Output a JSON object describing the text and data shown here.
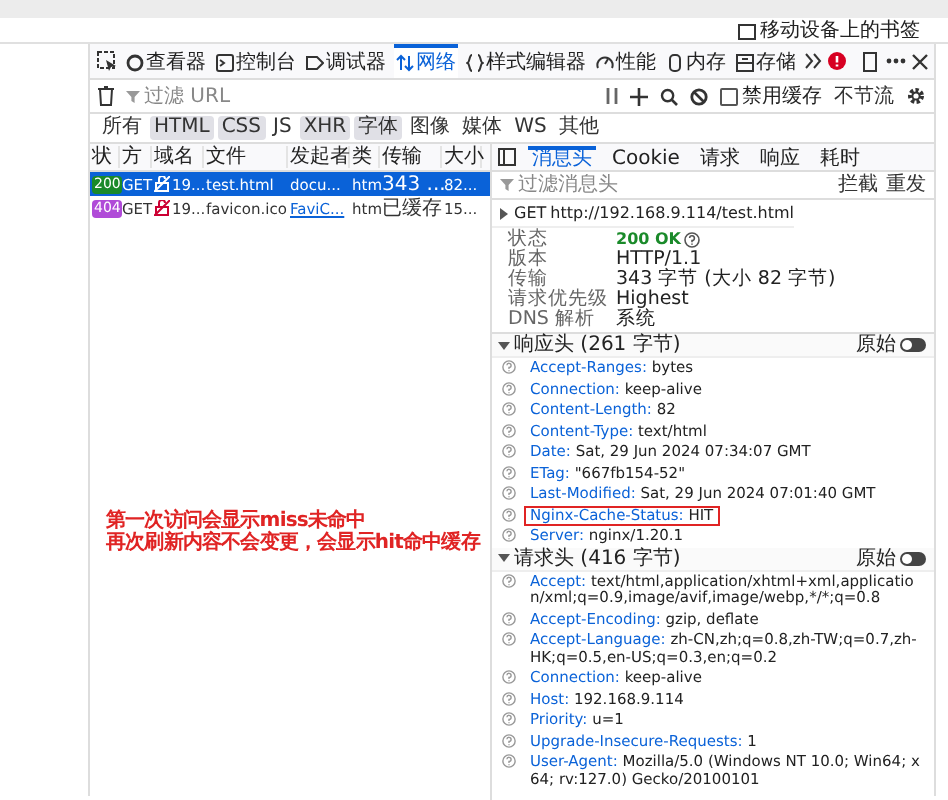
{
  "bookmarks_bar": {
    "label": "移动设备上的书签"
  },
  "toolbar": {
    "tabs": [
      {
        "label": "查看器",
        "selected": false
      },
      {
        "label": "控制台",
        "selected": false
      },
      {
        "label": "调试器",
        "selected": false
      },
      {
        "label": "网络",
        "selected": true
      },
      {
        "label": "样式编辑器",
        "selected": false
      },
      {
        "label": "性能",
        "selected": false
      },
      {
        "label": "内存",
        "selected": false
      },
      {
        "label": "存储",
        "selected": false
      }
    ]
  },
  "filter_bar": {
    "placeholder": "过滤 URL",
    "disable_cache": {
      "label": "禁用缓存",
      "checked": false
    },
    "throttle": "不节流"
  },
  "type_filters": [
    {
      "label": "所有",
      "selected": false
    },
    {
      "label": "HTML",
      "selected": true
    },
    {
      "label": "CSS",
      "selected": true
    },
    {
      "label": "JS",
      "selected": false
    },
    {
      "label": "XHR",
      "selected": true
    },
    {
      "label": "字体",
      "selected": true
    },
    {
      "label": "图像",
      "selected": false
    },
    {
      "label": "媒体",
      "selected": false
    },
    {
      "label": "WS",
      "selected": false
    },
    {
      "label": "其他",
      "selected": false
    }
  ],
  "requests": {
    "columns": [
      "状",
      "方",
      "域名",
      "文件",
      "发起者",
      "类",
      "传输",
      "大小"
    ],
    "rows": [
      {
        "status": "200",
        "color": "#1a8a2a",
        "method": "GET",
        "domain": "19...",
        "file": "test.html",
        "initiator": "docu...",
        "type": "htm",
        "transferred": "343 ...",
        "size": "82...",
        "selected": true
      },
      {
        "status": "404",
        "color": "#b04bd8",
        "method": "GET",
        "domain": "19...",
        "file": "favicon.ico",
        "initiator": "FaviC...",
        "type": "htm",
        "transferred": "已缓存",
        "size": "15...",
        "selected": false
      }
    ]
  },
  "details": {
    "tabs": [
      {
        "label": "消息头",
        "selected": true
      },
      {
        "label": "Cookie",
        "selected": false
      },
      {
        "label": "请求",
        "selected": false
      },
      {
        "label": "响应",
        "selected": false
      },
      {
        "label": "耗时",
        "selected": false
      }
    ],
    "filter_placeholder": "过滤消息头",
    "actions": [
      "拦截",
      "重发"
    ],
    "request_line": {
      "expanded": false,
      "method": "GET",
      "url": "http://192.168.9.114/test.html"
    },
    "summary": [
      {
        "kind": "status",
        "label": "状态",
        "value": "200 OK"
      },
      {
        "kind": "text",
        "label": "版本",
        "value": "HTTP/1.1"
      },
      {
        "kind": "text",
        "label": "传输",
        "value": "343 字节 (大小 82 字节)"
      },
      {
        "kind": "text",
        "label": "请求优先级",
        "value": "Highest"
      },
      {
        "kind": "text",
        "label": "DNS 解析",
        "value": "系统"
      }
    ],
    "sections": [
      {
        "title": "响应头 (261 字节)",
        "expanded": true,
        "raw_label": "原始",
        "raw_on": false,
        "headers": [
          {
            "name": "Accept-Ranges:",
            "value": "bytes",
            "highlighted": false
          },
          {
            "name": "Connection:",
            "value": "keep-alive",
            "highlighted": false
          },
          {
            "name": "Content-Length:",
            "value": "82",
            "highlighted": false
          },
          {
            "name": "Content-Type:",
            "value": "text/html",
            "highlighted": false
          },
          {
            "name": "Date:",
            "value": "Sat, 29 Jun 2024 07:34:07 GMT",
            "highlighted": false
          },
          {
            "name": "ETag:",
            "value": "\"667fb154-52\"",
            "highlighted": false
          },
          {
            "name": "Last-Modified:",
            "value": "Sat, 29 Jun 2024 07:01:40 GMT",
            "highlighted": false
          },
          {
            "name": "Nginx-Cache-Status:",
            "value": "HIT",
            "highlighted": true
          },
          {
            "name": "Server:",
            "value": "nginx/1.20.1",
            "highlighted": false
          }
        ]
      },
      {
        "title": "请求头 (416 字节)",
        "expanded": true,
        "raw_label": "原始",
        "raw_on": false,
        "headers": [
          {
            "name": "Accept:",
            "value": "text/html,application/xhtml+xml,application/xml;q=0.9,image/avif,image/webp,*/*;q=0.8",
            "highlighted": false
          },
          {
            "name": "Accept-Encoding:",
            "value": "gzip, deflate",
            "highlighted": false
          },
          {
            "name": "Accept-Language:",
            "value": "zh-CN,zh;q=0.8,zh-TW;q=0.7,zh-HK;q=0.5,en-US;q=0.3,en;q=0.2",
            "highlighted": false
          },
          {
            "name": "Connection:",
            "value": "keep-alive",
            "highlighted": false
          },
          {
            "name": "Host:",
            "value": "192.168.9.114",
            "highlighted": false
          },
          {
            "name": "Priority:",
            "value": "u=1",
            "highlighted": false
          },
          {
            "name": "Upgrade-Insecure-Requests:",
            "value": "1",
            "highlighted": false
          },
          {
            "name": "User-Agent:",
            "value": "Mozilla/5.0 (Windows NT 10.0; Win64; x64; rv:127.0) Gecko/20100101",
            "highlighted": false
          }
        ]
      }
    ]
  },
  "annotation": {
    "lines": [
      "第一次访问会显示miss未命中",
      "再次刷新内容不会变更，会显示hit命中缓存"
    ]
  }
}
